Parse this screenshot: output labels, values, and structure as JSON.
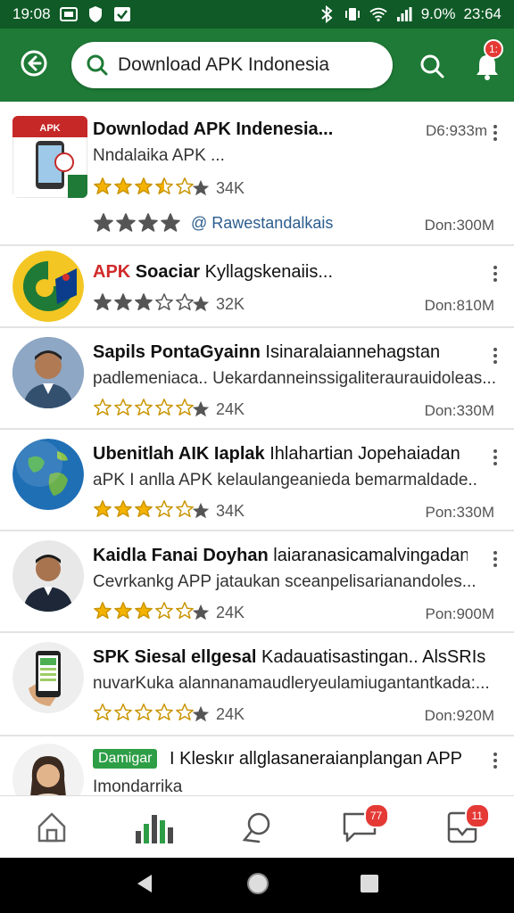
{
  "status_bar": {
    "time": "19:08",
    "battery": "9.0%",
    "clock_right": "23:64"
  },
  "header": {
    "search_value": "Download APK Indonesia",
    "notification_count": "1:"
  },
  "items": [
    {
      "title": "Downlodad APK Indenesia...",
      "subtitle": "Nndalaika APK ...",
      "rating": "34K",
      "size": "D6:933m",
      "link": "@ Rawestandalkais",
      "downloads": "Don:300M",
      "stars": [
        1,
        1,
        1,
        0.5,
        0
      ],
      "stars_second_row": [
        1,
        1,
        1,
        1
      ],
      "thumb": "apk-indonesia-logo"
    },
    {
      "title_red": "APK",
      "title": "Soaciar",
      "title_normal": "Kyllagskenaiis...",
      "rating": "32K",
      "downloads": "Don:810M",
      "stars": [
        1,
        1,
        1,
        0,
        0
      ],
      "thumb": "green-yellow-logo"
    },
    {
      "title": "Sapils PontaGyainn",
      "title_normal": "Isinaralaiannehagstan",
      "subtitle": "padlemeniaca.. Uekardanneinssigaliteraurauidoleas...",
      "rating": "24K",
      "downloads": "Don:330M",
      "stars": [
        0,
        0,
        0,
        0,
        0
      ],
      "thumb": "person-avatar"
    },
    {
      "title": "Ubenitlah AIK Iaplak",
      "title_normal": "Ihlahartian Jopehaiadan",
      "subtitle": "aPK I anlla APK kelaulangeanieda bemarmaldade..",
      "rating": "34K",
      "downloads": "Pon:330M",
      "stars": [
        1,
        1,
        1,
        0,
        0
      ],
      "thumb": "globe-image"
    },
    {
      "title": "Kaidla Fanai Doyhan",
      "title_normal": "laiaranasicamalvingadan",
      "subtitle": "Cevrkankg APP jataukan sceanpelisarianandoles...",
      "rating": "24K",
      "downloads": "Pon:900M",
      "stars": [
        1,
        1,
        1,
        0,
        0
      ],
      "thumb": "person-avatar"
    },
    {
      "title": "SPK Siesal ellgesal",
      "title_normal": "Kadauatisastingan.. AlsSRIslk",
      "subtitle": "nuvarKuka alannanamaudleryeulamiugantantkada:...",
      "rating": "24K",
      "downloads": "Don:920M",
      "stars": [
        0,
        0,
        0,
        0,
        0
      ],
      "thumb": "phone-in-hand"
    },
    {
      "tag": "Damigar",
      "title": "I Kleskır allglasaneraianplangan APP",
      "subtitle": "Imondarrika",
      "thumb": "person-avatar"
    }
  ],
  "bottom_nav": {
    "items": [
      {
        "icon": "home-icon"
      },
      {
        "icon": "bar-chart-icon"
      },
      {
        "icon": "search-map-icon"
      },
      {
        "icon": "chat-icon",
        "badge": "77"
      },
      {
        "icon": "inbox-icon",
        "badge": "11"
      }
    ]
  },
  "colors": {
    "header_green": "#1e7a36",
    "status_green": "#0f5a26",
    "star_gold": "#f5b301",
    "star_grey": "#555555"
  }
}
